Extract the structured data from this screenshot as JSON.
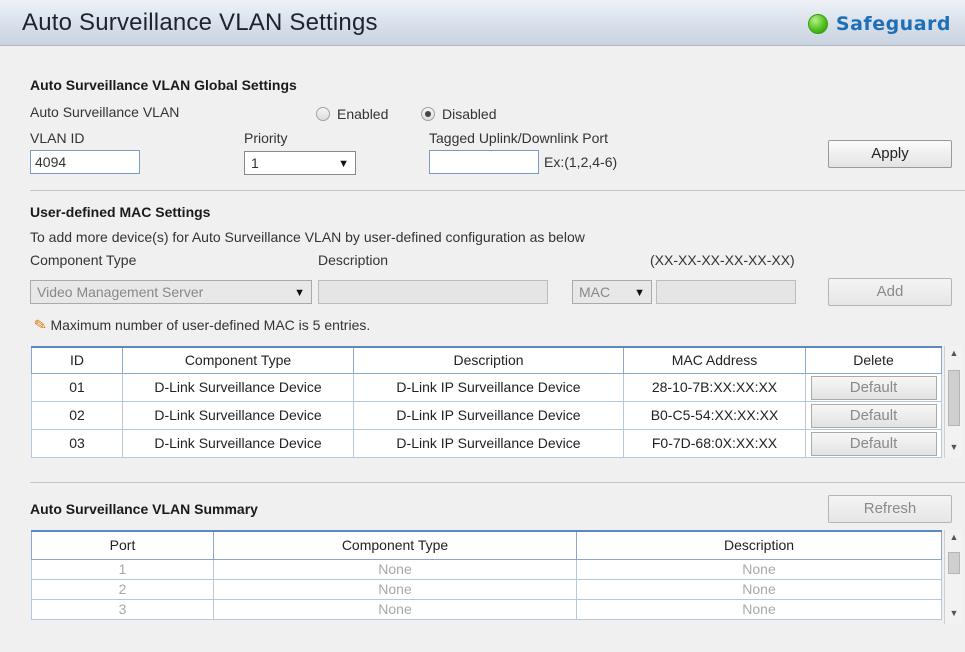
{
  "header": {
    "title": "Auto Surveillance VLAN Settings",
    "brand": "Safeguard",
    "brand_status_color": "#4fc11c"
  },
  "global": {
    "section_title": "Auto Surveillance VLAN Global Settings",
    "vlan_label": "Auto Surveillance VLAN",
    "enabled_label": "Enabled",
    "disabled_label": "Disabled",
    "selected_state": "Disabled",
    "vlan_id_label": "VLAN ID",
    "vlan_id_value": "4094",
    "priority_label": "Priority",
    "priority_value": "1",
    "tagged_label": "Tagged Uplink/Downlink Port",
    "tagged_value": "",
    "tagged_hint": "Ex:(1,2,4-6)",
    "apply_label": "Apply"
  },
  "mac_settings": {
    "section_title": "User-defined MAC Settings",
    "instruction": "To add more device(s) for Auto Surveillance VLAN by user-defined configuration as below",
    "component_type_label": "Component Type",
    "description_label": "Description",
    "mac_format_label": "(XX-XX-XX-XX-XX-XX)",
    "component_type_value": "Video Management Server",
    "description_value": "",
    "mac_type_value": "MAC",
    "mac_value": "",
    "add_label": "Add",
    "note": "Maximum number of user-defined MAC is 5 entries.",
    "note_icon": "pencil-icon"
  },
  "mac_table": {
    "columns": [
      "ID",
      "Component Type",
      "Description",
      "MAC Address",
      "Delete"
    ],
    "rows": [
      {
        "id": "01",
        "component": "D-Link Surveillance Device",
        "description": "D-Link IP Surveillance Device",
        "mac": "28-10-7B:XX:XX:XX",
        "delete": "Default"
      },
      {
        "id": "02",
        "component": "D-Link Surveillance Device",
        "description": "D-Link IP Surveillance Device",
        "mac": "B0-C5-54:XX:XX:XX",
        "delete": "Default"
      },
      {
        "id": "03",
        "component": "D-Link Surveillance Device",
        "description": "D-Link IP Surveillance Device",
        "mac": "F0-7D-68:0X:XX:XX",
        "delete": "Default"
      }
    ]
  },
  "summary": {
    "section_title": "Auto Surveillance VLAN Summary",
    "refresh_label": "Refresh",
    "columns": [
      "Port",
      "Component Type",
      "Description"
    ],
    "rows": [
      {
        "port": "1",
        "component": "None",
        "description": "None"
      },
      {
        "port": "2",
        "component": "None",
        "description": "None"
      },
      {
        "port": "3",
        "component": "None",
        "description": "None"
      }
    ]
  }
}
